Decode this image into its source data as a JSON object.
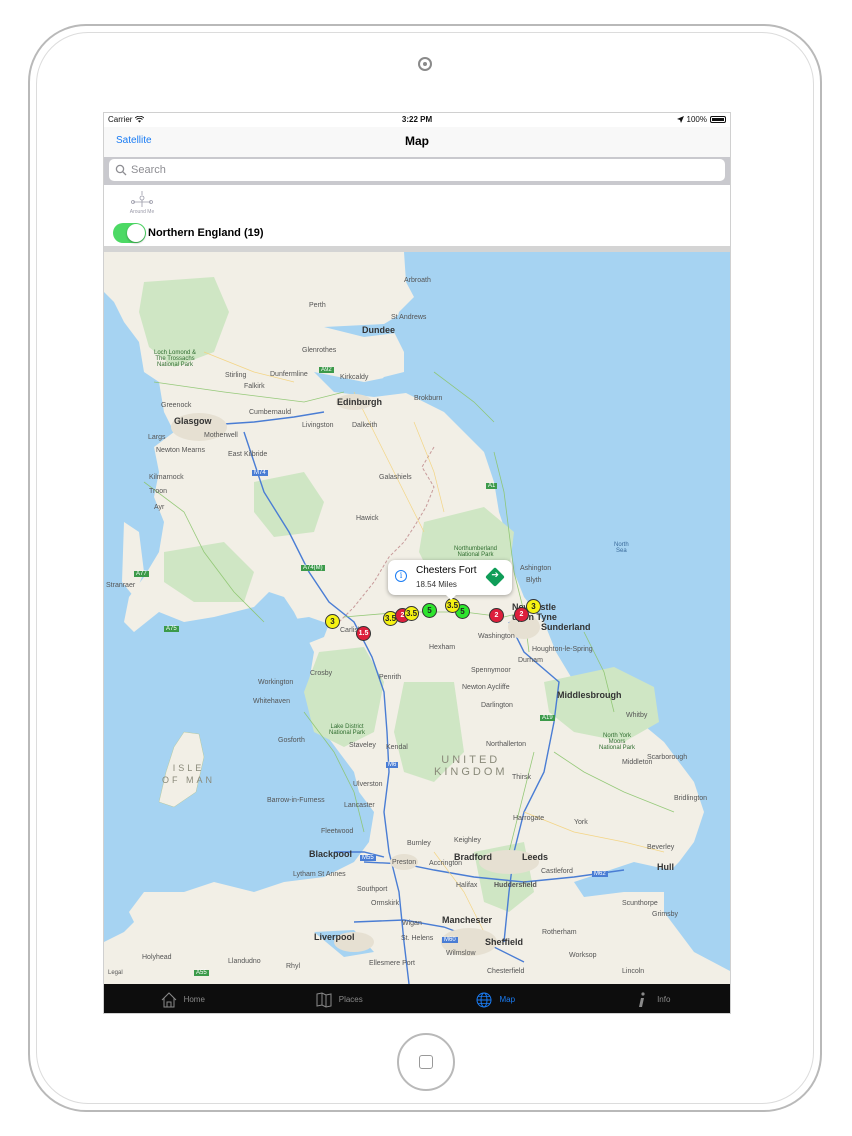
{
  "status_bar": {
    "carrier": "Carrier",
    "time": "3:22 PM",
    "battery": "100%"
  },
  "nav_bar": {
    "left_button": "Satellite",
    "title": "Map"
  },
  "search": {
    "placeholder": "Search"
  },
  "filter": {
    "around_me_label": "Around Me",
    "toggle_on": true,
    "region_label": "Northern England (19)"
  },
  "map": {
    "legal": "Legal",
    "country_label_line1": "UNITED",
    "country_label_line2": "KINGDOM",
    "isle_label_line1": "ISLE",
    "isle_label_line2": "OF MAN",
    "sea_label_line1": "North",
    "sea_label_line2": "Sea",
    "parks": [
      {
        "line1": "Loch Lomond &",
        "line2": "The Trossachs",
        "line3": "National Park"
      },
      {
        "line1": "Northumberland",
        "line2": "National Park"
      },
      {
        "line1": "Lake District",
        "line2": "National Park"
      },
      {
        "line1": "North York",
        "line2": "Moors",
        "line3": "National Park"
      }
    ],
    "cities": [
      "Glasgow",
      "Edinburgh",
      "Dundee",
      "Newcastle upon Tyne",
      "Sunderland",
      "Middlesbrough",
      "Bradford",
      "Leeds",
      "Hull",
      "Liverpool",
      "Manchester",
      "Sheffield",
      "Blackpool",
      "Preston",
      "Huddersfield",
      "Carlisle"
    ],
    "towns": [
      "Arbroath",
      "Perth",
      "St Andrews",
      "Glenrothes",
      "Dunfermline",
      "Kirkcaldy",
      "Stirling",
      "Falkirk",
      "Cumbernauld",
      "Livingston",
      "Dalkeith",
      "Greenock",
      "Largs",
      "Motherwell",
      "East Kilbride",
      "Newton Mearns",
      "Kilmarnock",
      "Troon",
      "Ayr",
      "Galashiels",
      "Hawick",
      "Brokburn",
      "Ashington",
      "Blyth",
      "Washington",
      "Houghton-le-Spring",
      "Durham",
      "Spennymoor",
      "Newton Aycliffe",
      "Darlington",
      "Whitby",
      "Scarborough",
      "Middleton",
      "Northallerton",
      "Thirsk",
      "Bridlington",
      "Harrogate",
      "York",
      "Beverley",
      "Castleford",
      "Scunthorpe",
      "Grimsby",
      "Rotherham",
      "Worksop",
      "Lincoln",
      "Chesterfield",
      "Halifax",
      "Burnley",
      "Southport",
      "Wigan",
      "St. Helens",
      "Holyhead",
      "Llandudno",
      "Rhyl",
      "Ellesmere Port",
      "Wilmslow",
      "Lancaster",
      "Fleetwood",
      "Barrow-in-Furness",
      "Ulverston",
      "Kendal",
      "Staveley",
      "Penrith",
      "Workington",
      "Whitehaven",
      "Gosforth",
      "Crosby",
      "Stranraer",
      "Lytham St Annes",
      "Ormskirk",
      "Accrington",
      "Keighley",
      "Hexham"
    ],
    "road_labels": [
      "A92",
      "M74",
      "A74(M)",
      "A77",
      "A75",
      "A1",
      "A19",
      "M6",
      "M55",
      "M60",
      "M62",
      "A55",
      "M8"
    ],
    "pins": [
      {
        "label": "3",
        "color": "yellow"
      },
      {
        "label": "1.5",
        "color": "red"
      },
      {
        "label": "3.5",
        "color": "yellow"
      },
      {
        "label": "2",
        "color": "red"
      },
      {
        "label": "3.5",
        "color": "yellow"
      },
      {
        "label": "5",
        "color": "green"
      },
      {
        "label": "5",
        "color": "green"
      },
      {
        "label": "3.5",
        "color": "yellow"
      },
      {
        "label": "2",
        "color": "red"
      },
      {
        "label": "2",
        "color": "red"
      },
      {
        "label": "3",
        "color": "yellow"
      }
    ],
    "callout": {
      "title": "Chesters Fort",
      "distance": "18.54 Miles"
    }
  },
  "tab_bar": {
    "tabs": [
      {
        "label": "Home",
        "icon": "home-icon"
      },
      {
        "label": "Places",
        "icon": "map-book-icon"
      },
      {
        "label": "Map",
        "icon": "globe-icon"
      },
      {
        "label": "Info",
        "icon": "info-icon"
      }
    ],
    "active": "Map"
  },
  "colors": {
    "accent": "#1a7cf4",
    "toggle_on": "#4cd964",
    "pin_yellow": "#f5f213",
    "pin_green": "#2ee52e",
    "pin_red": "#dd1f3c",
    "sea": "#a6d3f2",
    "land": "#f2efe6"
  }
}
